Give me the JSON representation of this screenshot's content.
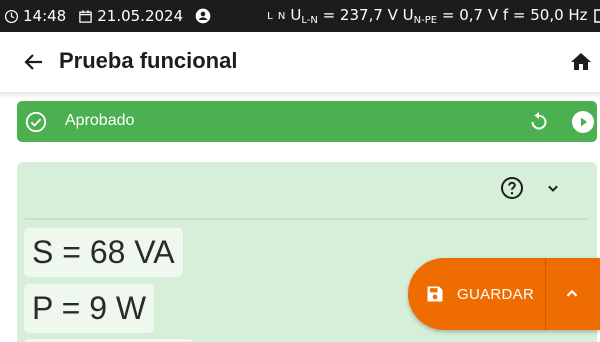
{
  "status_bar": {
    "time": "14:48",
    "date": "21.05.2024",
    "ln_indicator": "L N",
    "u_ln_label": "U",
    "u_ln_sub": "L-N",
    "u_ln_value": " = 237,7 V ",
    "u_npe_label": "U",
    "u_npe_sub": "N-PE",
    "u_npe_value": " = 0,7 V f = 50,0 Hz"
  },
  "header": {
    "title": "Prueba funcional"
  },
  "banner": {
    "status": "Aprobado",
    "color": "#4caf50"
  },
  "results": {
    "apparent_power": "S = 68 VA",
    "active_power": "P = 9 W"
  },
  "fab": {
    "save_label": "GUARDAR",
    "color": "#ef6c00"
  },
  "icons": [
    "clock-icon",
    "calendar-icon",
    "user-icon",
    "battery-icon",
    "back-arrow-icon",
    "home-icon",
    "check-circle-icon",
    "retry-icon",
    "play-icon",
    "help-icon",
    "chevron-down-icon",
    "save-icon",
    "chevron-up-icon"
  ]
}
